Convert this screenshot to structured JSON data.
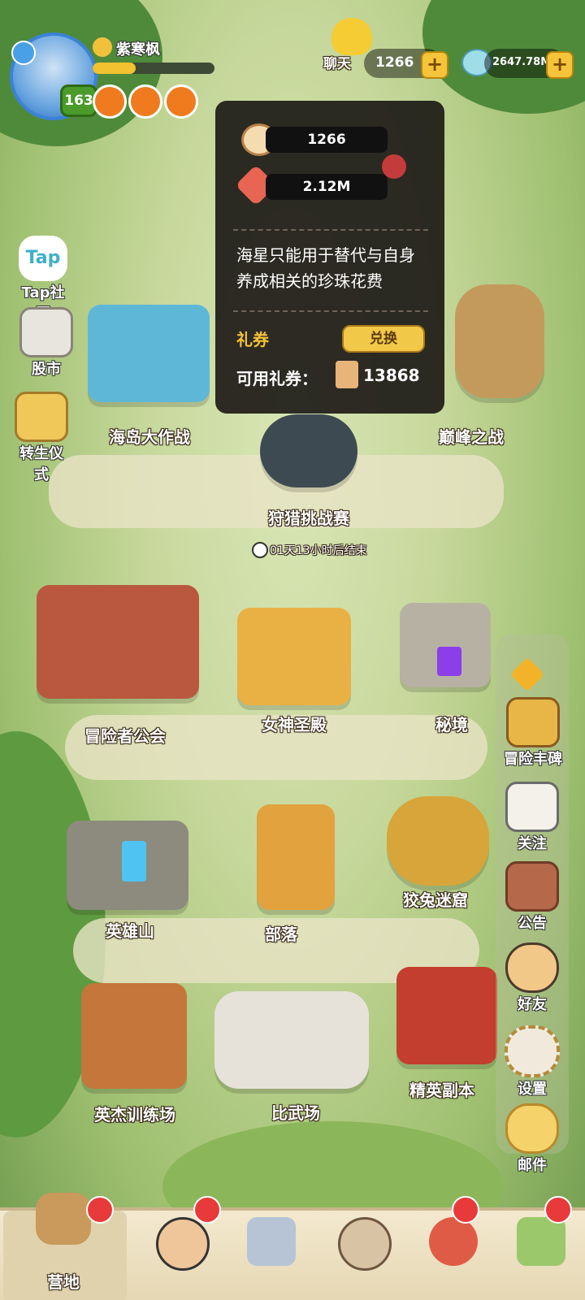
{
  "player": {
    "name": "紫寒枫",
    "level": "163",
    "xp_fraction": 0.35
  },
  "resources": {
    "pearls": "1266",
    "diamonds": "2647.78M",
    "chat_label": "聊天"
  },
  "left_menu": [
    {
      "label": "Tap社区",
      "icon": "tap-community-icon"
    },
    {
      "label": "股市",
      "icon": "stock-market-icon"
    },
    {
      "label": "转生仪式",
      "icon": "rebirth-ceremony-icon"
    }
  ],
  "popup": {
    "pearl_value": "1266",
    "starfish_value": "2.12M",
    "description": "海星只能用于替代与自身养成相关的珍珠花费",
    "voucher_title": "礼券",
    "exchange_button": "兑换",
    "available_label": "可用礼券：",
    "available_value": "13868"
  },
  "locations": {
    "island_battle": "海岛大作战",
    "peak_battle": "巅峰之战",
    "hunting": "狩猎挑战赛",
    "hunting_timer": "01天13小时后结束",
    "adventurer_guild": "冒险者公会",
    "goddess_temple": "女神圣殿",
    "secret_realm": "秘境",
    "hero_mountain": "英雄山",
    "tribe": "部落",
    "rabbit_maze": "狡兔迷窟",
    "training_ground": "英杰训练场",
    "arena": "比武场",
    "elite_dungeon": "精英副本"
  },
  "right_menu": [
    {
      "label": "冒险丰碑",
      "icon": "monument-icon"
    },
    {
      "label": "关注",
      "icon": "qr-follow-icon"
    },
    {
      "label": "公告",
      "icon": "announcement-icon"
    },
    {
      "label": "好友",
      "icon": "friends-icon"
    },
    {
      "label": "设置",
      "icon": "settings-gear-icon"
    },
    {
      "label": "邮件",
      "icon": "mail-icon"
    }
  ],
  "bottom_nav": {
    "camp_label": "营地"
  },
  "colors": {
    "accent_gold": "#f6c43a",
    "notif_red": "#e83a3a",
    "level_green": "#4a9b2a"
  }
}
